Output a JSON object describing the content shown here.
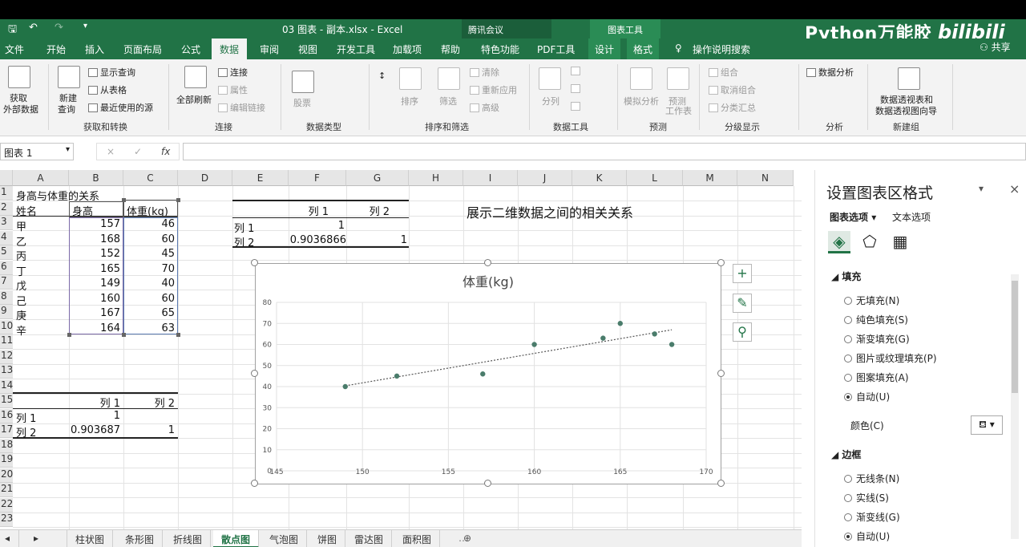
{
  "titlebar": {
    "save_icon": "save-icon",
    "undo_icon": "undo-icon",
    "redo_icon": "redo-icon",
    "document_title": "03 图表 - 副本.xlsx  -  Excel",
    "meeting_label": "腾讯会议",
    "context_label": "图表工具",
    "brand_text": "Python万能胶",
    "bili_text": "bilibili",
    "share_label": "共享"
  },
  "tabs": [
    "文件",
    "开始",
    "插入",
    "页面布局",
    "公式",
    "数据",
    "审阅",
    "视图",
    "开发工具",
    "加载项",
    "帮助",
    "特色功能",
    "PDF工具",
    "设计",
    "格式",
    "操作说明搜索"
  ],
  "active_tab": "数据",
  "ribbon": {
    "get_external": "获取",
    "get_external_2": "外部数据",
    "new_query": "新建",
    "new_query_2": "查询",
    "show_queries": "显示查询",
    "from_table": "从表格",
    "recent_sources": "最近使用的源",
    "group_get": "获取和转换",
    "refresh_all": "全部刷新",
    "connections": "连接",
    "properties": "属性",
    "edit_links": "编辑链接",
    "group_conn": "连接",
    "stocks": "股票",
    "group_types": "数据类型",
    "sort": "排序",
    "filter": "筛选",
    "clear": "清除",
    "reapply": "重新应用",
    "advanced": "高级",
    "group_sort": "排序和筛选",
    "split": "分列",
    "group_tools": "数据工具",
    "whatif": "模拟分析",
    "forecast": "预测",
    "forecast_2": "工作表",
    "group_forecast": "预测",
    "group": "组合",
    "ungroup": "取消组合",
    "subtotal": "分类汇总",
    "group_outline": "分级显示",
    "analysis": "数据分析",
    "group_analysis": "分析",
    "pivot": "数据透视表和",
    "pivot_2": "数据透视图向导",
    "group_new": "新建组"
  },
  "formula_bar": {
    "name_box": "图表 1",
    "cancel": "×",
    "enter": "✓",
    "fx": "fx",
    "formula": ""
  },
  "columns": [
    "A",
    "B",
    "C",
    "D",
    "E",
    "F",
    "G",
    "H",
    "I",
    "J",
    "K",
    "L",
    "M",
    "N"
  ],
  "rows": [
    "1",
    "2",
    "3",
    "4",
    "5",
    "6",
    "7",
    "8",
    "9",
    "10",
    "11",
    "12",
    "13",
    "14",
    "15",
    "16",
    "17",
    "18",
    "19",
    "20",
    "21",
    "22",
    "23"
  ],
  "sheet": {
    "title": "身高与体重的关系",
    "headers": [
      "姓名",
      "身高",
      "体重(kg)"
    ],
    "records": [
      {
        "name": "甲",
        "height": "157",
        "weight": "46"
      },
      {
        "name": "乙",
        "height": "168",
        "weight": "60"
      },
      {
        "name": "丙",
        "height": "152",
        "weight": "45"
      },
      {
        "name": "丁",
        "height": "165",
        "weight": "70"
      },
      {
        "name": "戊",
        "height": "149",
        "weight": "40"
      },
      {
        "name": "己",
        "height": "160",
        "weight": "60"
      },
      {
        "name": "庚",
        "height": "167",
        "weight": "65"
      },
      {
        "name": "辛",
        "height": "164",
        "weight": "63"
      }
    ],
    "corr_left": {
      "col1": "列 1",
      "col2": "列 2",
      "row1": "列 1",
      "row1_v1": "1",
      "row2": "列 2",
      "row2_v1": "0.903687",
      "row2_v2": "1"
    },
    "corr_right": {
      "col1": "列 1",
      "col2": "列 2",
      "row1": "列 1",
      "row1_v1": "1",
      "row2": "列 2",
      "row2_v1": "0.9036866",
      "row2_v2": "1"
    },
    "note": "展示二维数据之间的相关关系"
  },
  "chart_data": {
    "type": "scatter",
    "title": "体重(kg)",
    "xlabel": "",
    "ylabel": "",
    "xlim": [
      145,
      170
    ],
    "ylim": [
      0,
      80
    ],
    "xticks": [
      "145",
      "150",
      "155",
      "160",
      "165",
      "170"
    ],
    "yticks": [
      "0",
      "10",
      "20",
      "30",
      "40",
      "50",
      "60",
      "70",
      "80"
    ],
    "x": [
      157,
      168,
      152,
      165,
      149,
      160,
      167,
      164
    ],
    "y": [
      46,
      60,
      45,
      70,
      40,
      60,
      65,
      63
    ],
    "trendline": "linear",
    "grid": true,
    "legend": "none",
    "marker_color": "#4a7c6b"
  },
  "chart_buttons": [
    "plus-icon",
    "brush-icon",
    "filter-icon"
  ],
  "pane": {
    "title": "设置图表区格式",
    "option_chart": "图表选项",
    "option_text": "文本选项",
    "section_fill": "填充",
    "fill_options": [
      "无填充(N)",
      "纯色填充(S)",
      "渐变填充(G)",
      "图片或纹理填充(P)",
      "图案填充(A)",
      "自动(U)"
    ],
    "fill_selected": 5,
    "color_label": "颜色(C)",
    "section_border": "边框",
    "border_options": [
      "无线条(N)",
      "实线(S)",
      "渐变线(G)",
      "自动(U)"
    ],
    "border_selected": 3
  },
  "sheet_tabs": [
    "柱状图",
    "条形图",
    "折线图",
    "散点图",
    "气泡图",
    "饼图",
    "雷达图",
    "面积图"
  ],
  "active_sheet": "散点图",
  "colors": {
    "excel_green": "#217346",
    "header_gray": "#e6e6e6"
  }
}
